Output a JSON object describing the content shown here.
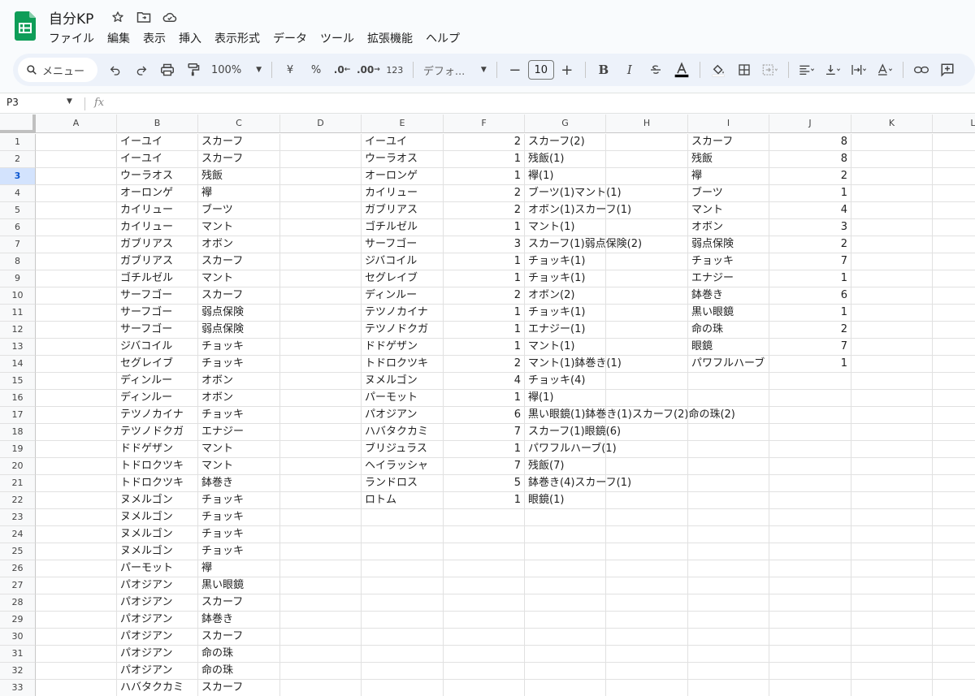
{
  "app": {
    "doc_title": "自分KP",
    "menu": [
      "ファイル",
      "編集",
      "表示",
      "挿入",
      "表示形式",
      "データ",
      "ツール",
      "拡張機能",
      "ヘルプ"
    ]
  },
  "toolbar": {
    "search_label": "メニュー",
    "zoom": "100%",
    "currency": "¥",
    "percent": "%",
    "dec_minus": ".0",
    "dec_plus": ".00",
    "number_format": "123",
    "font": "デフォ...",
    "font_size": "10",
    "bold": "B",
    "italic": "I"
  },
  "formula_bar": {
    "name_box": "P3",
    "fx": "fx",
    "content": ""
  },
  "sheet": {
    "columns": [
      "A",
      "B",
      "C",
      "D",
      "E",
      "F",
      "G",
      "H",
      "I",
      "J",
      "K",
      "L"
    ],
    "selected_row": 3,
    "rows": [
      {
        "n": "1",
        "B": "イーユイ",
        "C": "スカーフ",
        "E": "イーユイ",
        "F": "2",
        "G": "スカーフ(2)",
        "I": "スカーフ",
        "J": "8"
      },
      {
        "n": "2",
        "B": "イーユイ",
        "C": "スカーフ",
        "E": "ウーラオス",
        "F": "1",
        "G": "残飯(1)",
        "I": "残飯",
        "J": "8"
      },
      {
        "n": "3",
        "B": "ウーラオス",
        "C": "残飯",
        "E": "オーロンゲ",
        "F": "1",
        "G": "襷(1)",
        "I": "襷",
        "J": "2"
      },
      {
        "n": "4",
        "B": "オーロンゲ",
        "C": "襷",
        "E": "カイリュー",
        "F": "2",
        "G": "ブーツ(1)マント(1)",
        "I": "ブーツ",
        "J": "1"
      },
      {
        "n": "5",
        "B": "カイリュー",
        "C": "ブーツ",
        "E": "ガブリアス",
        "F": "2",
        "G": "オボン(1)スカーフ(1)",
        "I": "マント",
        "J": "4"
      },
      {
        "n": "6",
        "B": "カイリュー",
        "C": "マント",
        "E": "ゴチルゼル",
        "F": "1",
        "G": "マント(1)",
        "I": "オボン",
        "J": "3"
      },
      {
        "n": "7",
        "B": "ガブリアス",
        "C": "オボン",
        "E": "サーフゴー",
        "F": "3",
        "G": "スカーフ(1)弱点保険(2)",
        "I": "弱点保険",
        "J": "2"
      },
      {
        "n": "8",
        "B": "ガブリアス",
        "C": "スカーフ",
        "E": "ジバコイル",
        "F": "1",
        "G": "チョッキ(1)",
        "I": "チョッキ",
        "J": "7"
      },
      {
        "n": "9",
        "B": "ゴチルゼル",
        "C": "マント",
        "E": "セグレイブ",
        "F": "1",
        "G": "チョッキ(1)",
        "I": "エナジー",
        "J": "1"
      },
      {
        "n": "10",
        "B": "サーフゴー",
        "C": "スカーフ",
        "E": "ディンルー",
        "F": "2",
        "G": "オボン(2)",
        "I": "鉢巻き",
        "J": "6"
      },
      {
        "n": "11",
        "B": "サーフゴー",
        "C": "弱点保険",
        "E": "テツノカイナ",
        "F": "1",
        "G": "チョッキ(1)",
        "I": "黒い眼鏡",
        "J": "1"
      },
      {
        "n": "12",
        "B": "サーフゴー",
        "C": "弱点保険",
        "E": "テツノドクガ",
        "F": "1",
        "G": "エナジー(1)",
        "I": "命の珠",
        "J": "2"
      },
      {
        "n": "13",
        "B": "ジバコイル",
        "C": "チョッキ",
        "E": "ドドゲザン",
        "F": "1",
        "G": "マント(1)",
        "I": "眼鏡",
        "J": "7"
      },
      {
        "n": "14",
        "B": "セグレイブ",
        "C": "チョッキ",
        "E": "トドロクツキ",
        "F": "2",
        "G": "マント(1)鉢巻き(1)",
        "I": "パワフルハーブ",
        "J": "1"
      },
      {
        "n": "15",
        "B": "ディンルー",
        "C": "オボン",
        "E": "ヌメルゴン",
        "F": "4",
        "G": "チョッキ(4)"
      },
      {
        "n": "16",
        "B": "ディンルー",
        "C": "オボン",
        "E": "パーモット",
        "F": "1",
        "G": "襷(1)"
      },
      {
        "n": "17",
        "B": "テツノカイナ",
        "C": "チョッキ",
        "E": "パオジアン",
        "F": "6",
        "G": "黒い眼鏡(1)鉢巻き(1)スカーフ(2)命の珠(2)"
      },
      {
        "n": "18",
        "B": "テツノドクガ",
        "C": "エナジー",
        "E": "ハバタクカミ",
        "F": "7",
        "G": "スカーフ(1)眼鏡(6)"
      },
      {
        "n": "19",
        "B": "ドドゲザン",
        "C": "マント",
        "E": "ブリジュラス",
        "F": "1",
        "G": "パワフルハーブ(1)"
      },
      {
        "n": "20",
        "B": "トドロクツキ",
        "C": "マント",
        "E": "ヘイラッシャ",
        "F": "7",
        "G": "残飯(7)"
      },
      {
        "n": "21",
        "B": "トドロクツキ",
        "C": "鉢巻き",
        "E": "ランドロス",
        "F": "5",
        "G": "鉢巻き(4)スカーフ(1)"
      },
      {
        "n": "22",
        "B": "ヌメルゴン",
        "C": "チョッキ",
        "E": "ロトム",
        "F": "1",
        "G": "眼鏡(1)"
      },
      {
        "n": "23",
        "B": "ヌメルゴン",
        "C": "チョッキ"
      },
      {
        "n": "24",
        "B": "ヌメルゴン",
        "C": "チョッキ"
      },
      {
        "n": "25",
        "B": "ヌメルゴン",
        "C": "チョッキ"
      },
      {
        "n": "26",
        "B": "パーモット",
        "C": "襷"
      },
      {
        "n": "27",
        "B": "パオジアン",
        "C": "黒い眼鏡"
      },
      {
        "n": "28",
        "B": "パオジアン",
        "C": "スカーフ"
      },
      {
        "n": "29",
        "B": "パオジアン",
        "C": "鉢巻き"
      },
      {
        "n": "30",
        "B": "パオジアン",
        "C": "スカーフ"
      },
      {
        "n": "31",
        "B": "パオジアン",
        "C": "命の珠"
      },
      {
        "n": "32",
        "B": "パオジアン",
        "C": "命の珠"
      },
      {
        "n": "33",
        "B": "ハバタクカミ",
        "C": "スカーフ"
      }
    ]
  }
}
